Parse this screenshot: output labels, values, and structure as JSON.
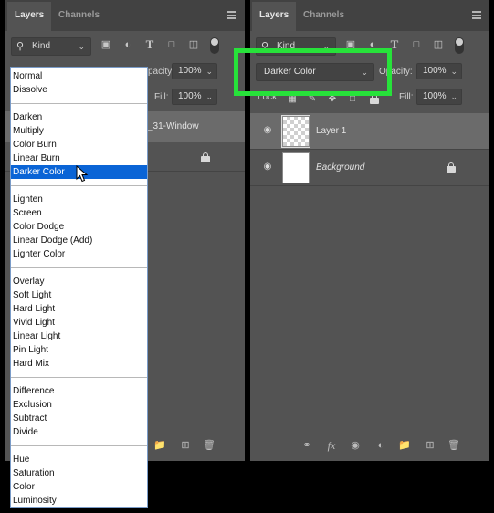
{
  "left_panel": {
    "tabs": [
      {
        "label": "Layers"
      },
      {
        "label": "Channels"
      }
    ],
    "filter_kind": "Kind",
    "opacity_label": "Opacity:",
    "opacity_partial_label": "pacity:",
    "opacity_value": "100%",
    "fill_label": "Fill:",
    "fill_value": "100%",
    "layer_partial_name": "_31-Window"
  },
  "right_panel": {
    "tabs": [
      {
        "label": "Layers"
      },
      {
        "label": "Channels"
      }
    ],
    "filter_kind": "Kind",
    "blend_mode": "Darker Color",
    "opacity_label": "Opacity:",
    "opacity_value": "100%",
    "lock_label": "Lock:",
    "fill_label": "Fill:",
    "fill_value": "100%",
    "layers": [
      {
        "name": "Layer 1",
        "visible": true,
        "locked": false,
        "selected": true
      },
      {
        "name": "Background",
        "visible": true,
        "locked": true,
        "selected": false
      }
    ]
  },
  "blend_menu": {
    "selected": "Darker Color",
    "groups": [
      [
        "Normal",
        "Dissolve"
      ],
      [
        "Darken",
        "Multiply",
        "Color Burn",
        "Linear Burn",
        "Darker Color"
      ],
      [
        "Lighten",
        "Screen",
        "Color Dodge",
        "Linear Dodge (Add)",
        "Lighter Color"
      ],
      [
        "Overlay",
        "Soft Light",
        "Hard Light",
        "Vivid Light",
        "Linear Light",
        "Pin Light",
        "Hard Mix"
      ],
      [
        "Difference",
        "Exclusion",
        "Subtract",
        "Divide"
      ],
      [
        "Hue",
        "Saturation",
        "Color",
        "Luminosity"
      ]
    ]
  },
  "colors": {
    "panel_bg": "#535353",
    "tab_bar_bg": "#424242",
    "menu_selection": "#0a64d6",
    "highlight_box": "#27e23a"
  }
}
